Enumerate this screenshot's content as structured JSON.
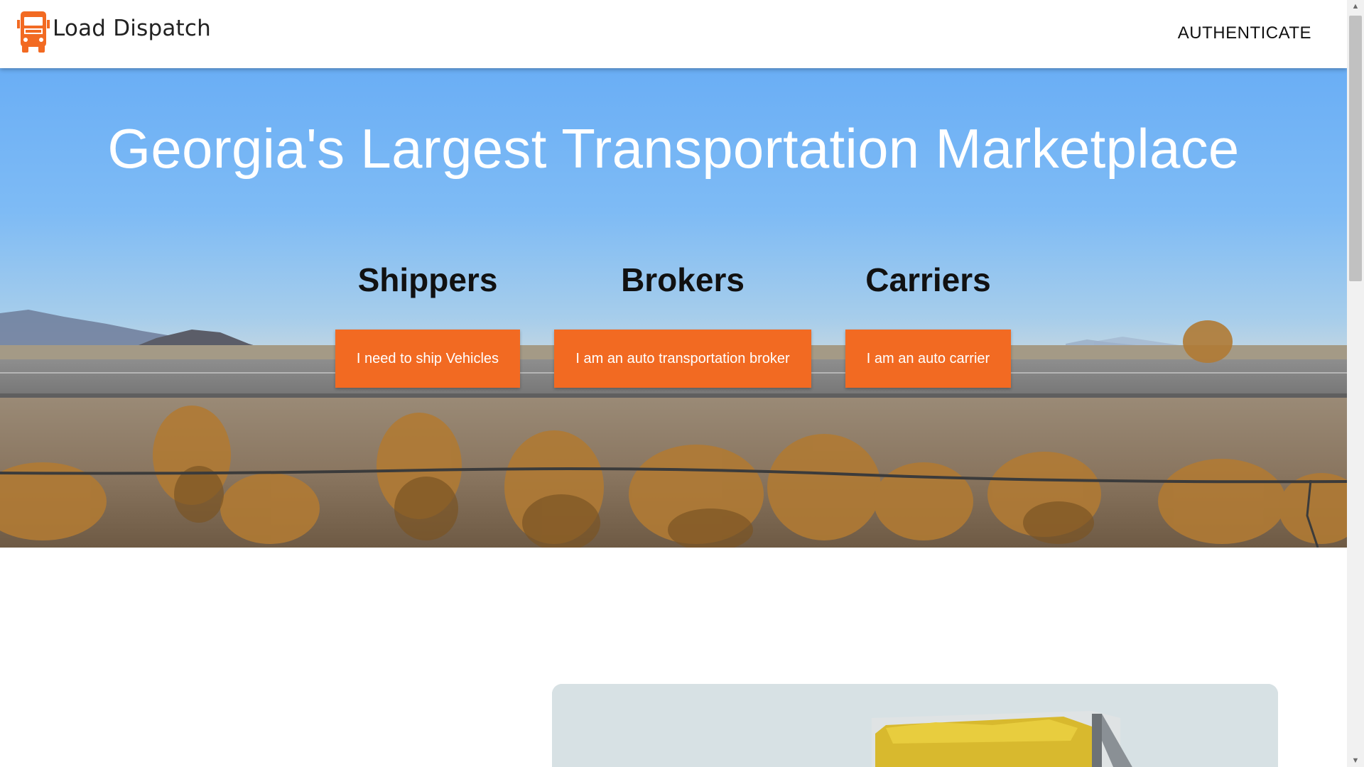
{
  "header": {
    "brand": "Load Dispatch",
    "logo_icon": "truck-icon",
    "auth_label": "AUTHENTICATE"
  },
  "hero": {
    "title": "Georgia's Largest Transportation Marketplace",
    "columns": [
      {
        "heading": "Shippers",
        "button": "I need to ship Vehicles"
      },
      {
        "heading": "Brokers",
        "button": "I am an auto transportation broker"
      },
      {
        "heading": "Carriers",
        "button": "I am an auto carrier"
      }
    ]
  },
  "colors": {
    "accent": "#f26a22",
    "sky": "#7ebbf5",
    "heading": "#111111"
  }
}
